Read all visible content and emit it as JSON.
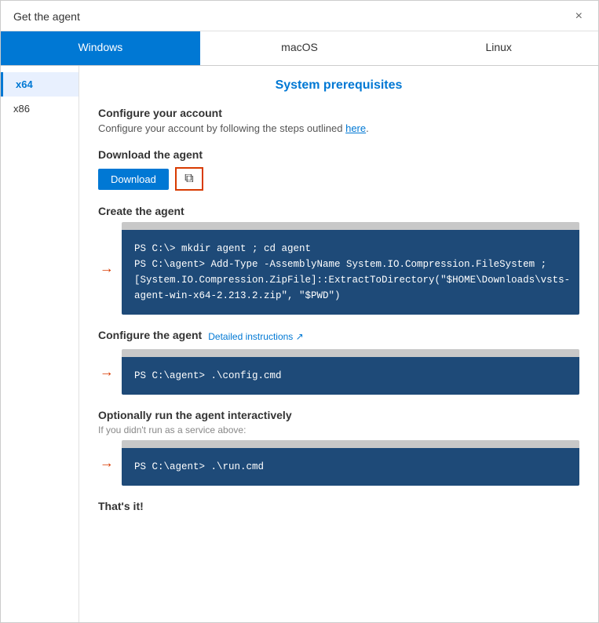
{
  "dialog": {
    "title": "Get the agent",
    "close_label": "×"
  },
  "os_tabs": [
    {
      "id": "windows",
      "label": "Windows",
      "active": true
    },
    {
      "id": "macos",
      "label": "macOS",
      "active": false
    },
    {
      "id": "linux",
      "label": "Linux",
      "active": false
    }
  ],
  "arch_items": [
    {
      "id": "x64",
      "label": "x64",
      "active": true
    },
    {
      "id": "x86",
      "label": "x86",
      "active": false
    }
  ],
  "main": {
    "prerequisites_title": "System prerequisites",
    "configure_account_heading": "Configure your account",
    "configure_account_text": "Configure your account by following the steps outlined ",
    "configure_account_link": "here",
    "download_heading": "Download the agent",
    "download_btn": "Download",
    "copy_icon": "⧉",
    "create_heading": "Create the agent",
    "create_code": "PS C:\\> mkdir agent ; cd agent\nPS C:\\agent> Add-Type -AssemblyName System.IO.Compression.FileSystem ;\n[System.IO.Compression.ZipFile]::ExtractToDirectory(\"$HOME\\Downloads\\vsts-\nagent-win-x64-2.213.2.zip\", \"$PWD\")",
    "configure_heading": "Configure the agent",
    "detailed_instructions": "Detailed instructions ↗",
    "configure_code": "PS C:\\agent> .\\config.cmd",
    "optional_heading": "Optionally run the agent interactively",
    "optional_subtext": "If you didn't run as a service above:",
    "run_code": "PS C:\\agent> .\\run.cmd",
    "thats_it": "That's it!"
  }
}
